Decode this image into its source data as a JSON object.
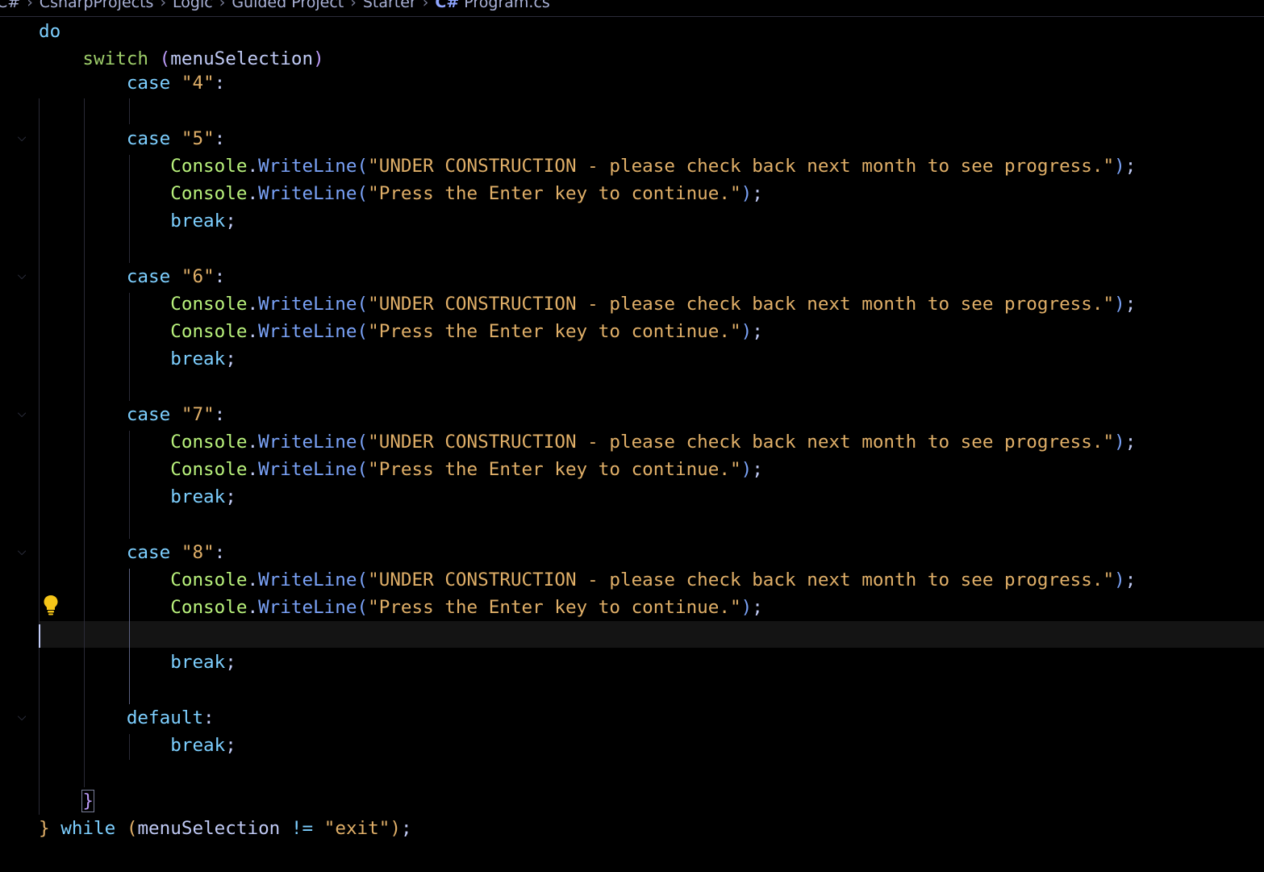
{
  "breadcrumb": {
    "items": [
      "C#",
      "CsharpProjects",
      "Logic",
      "Guided Project",
      "Starter"
    ],
    "file_icon": "C#",
    "file": "Program.cs"
  },
  "code": {
    "do": "do",
    "switch_kw": "switch",
    "switch_var": "menuSelection",
    "case_kw": "case",
    "cases": [
      "\"4\"",
      "\"5\"",
      "\"6\"",
      "\"7\"",
      "\"8\""
    ],
    "console": "Console",
    "writeline": "WriteLine",
    "msg1": "\"UNDER CONSTRUCTION - please check back next month to see progress.\"",
    "msg2": "\"Press the Enter key to continue.\"",
    "break_kw": "break",
    "default_kw": "default",
    "while_kw": "while",
    "while_var": "menuSelection",
    "while_op": "!=",
    "while_val": "\"exit\""
  },
  "colors": {
    "background": "#000000",
    "keyword": "#7dcfff",
    "class": "#b9f27c",
    "method": "#7aa2f7",
    "string": "#e0af68",
    "bracket_pair": "#bb9af7"
  },
  "icons": {
    "fold": "chevron-down-icon",
    "lightbulb": "lightbulb-icon",
    "csharp": "csharp-file-icon"
  }
}
